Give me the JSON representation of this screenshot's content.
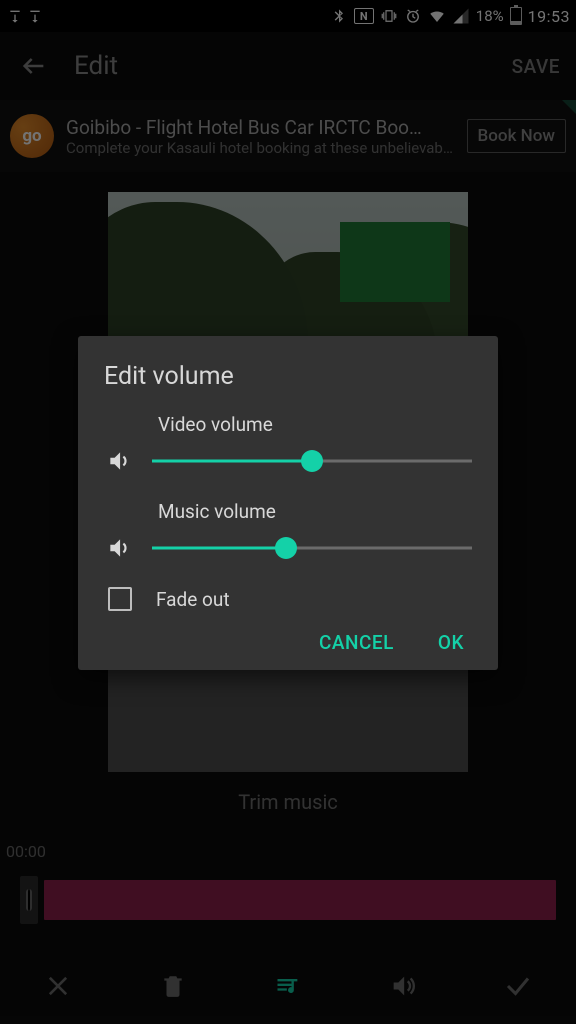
{
  "statusbar": {
    "battery_pct": "18%",
    "time": "19:53"
  },
  "toolbar": {
    "title": "Edit",
    "save_label": "SAVE"
  },
  "ad": {
    "logo_text": "go",
    "title": "Goibibo - Flight Hotel Bus Car IRCTC Boo…",
    "subtitle": "Complete your Kasauli hotel booking at these unbelievable …",
    "cta": "Book Now"
  },
  "trim": {
    "label": "Trim music",
    "time": "00:00"
  },
  "dialog": {
    "title": "Edit volume",
    "video_label": "Video volume",
    "video_pct": 50,
    "music_label": "Music volume",
    "music_pct": 42,
    "fade_label": "Fade out",
    "fade_checked": false,
    "cancel": "CANCEL",
    "ok": "OK"
  },
  "colors": {
    "accent": "#14d1a8",
    "timeline": "#8e1f4c"
  }
}
